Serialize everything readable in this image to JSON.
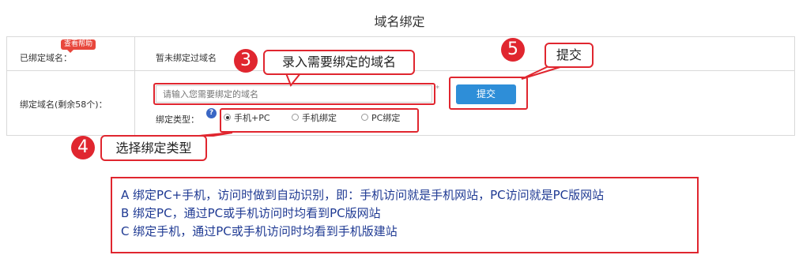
{
  "page": {
    "title": "域名绑定"
  },
  "form": {
    "bound_label": "已绑定域名：",
    "help_badge": "查看帮助",
    "bound_value": "暂未绑定过域名",
    "domain_label": "绑定域名(剩余58个)：",
    "domain_placeholder": "请输入您需要绑定的域名",
    "required_mark": "*",
    "submit_label": "提交",
    "bind_type_label": "绑定类型：",
    "help_icon": "?",
    "bind_options": [
      {
        "label": "手机+PC",
        "checked": true
      },
      {
        "label": "手机绑定",
        "checked": false
      },
      {
        "label": "PC绑定",
        "checked": false
      }
    ]
  },
  "annotations": {
    "step3": {
      "number": "3",
      "text": "录入需要绑定的域名"
    },
    "step4": {
      "number": "4",
      "text": "选择绑定类型"
    },
    "step5": {
      "number": "5",
      "text": "提交"
    }
  },
  "notes": [
    "A 绑定PC+手机，访问时做到自动识别，即：手机访问就是手机网站，PC访问就是PC版网站",
    "B 绑定PC，通过PC或手机访问时均看到PC版网站",
    "C 绑定手机，通过PC或手机访问时均看到手机版建站"
  ],
  "colors": {
    "accent_red": "#e0262f",
    "button_blue": "#2e8ed8",
    "note_text": "#1f3a93"
  }
}
